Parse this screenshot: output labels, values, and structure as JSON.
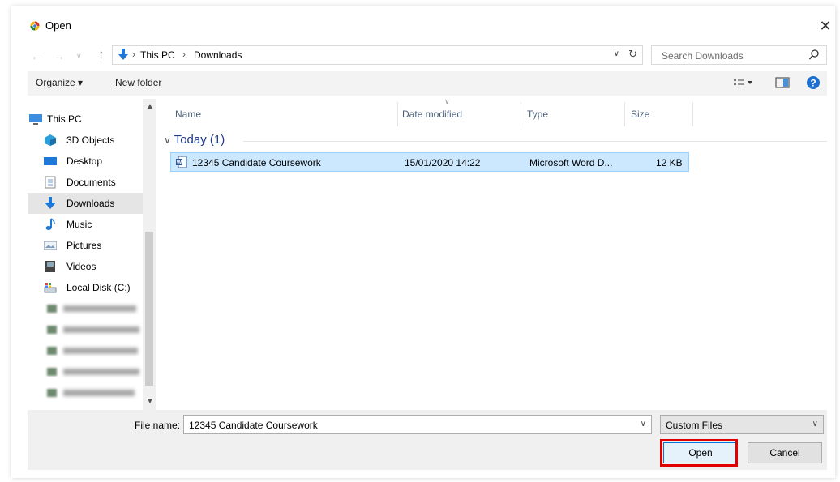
{
  "window": {
    "title": "Open",
    "close_glyph": "✕"
  },
  "address_bar": {
    "crumbs": [
      "This PC",
      "Downloads"
    ],
    "separator": "›",
    "search_placeholder": "Search Downloads"
  },
  "toolbar": {
    "organize_label": "Organize ▾",
    "new_folder_label": "New folder"
  },
  "sidebar": {
    "items": [
      {
        "label": "This PC"
      },
      {
        "label": "3D Objects"
      },
      {
        "label": "Desktop"
      },
      {
        "label": "Documents"
      },
      {
        "label": "Downloads"
      },
      {
        "label": "Music"
      },
      {
        "label": "Pictures"
      },
      {
        "label": "Videos"
      },
      {
        "label": "Local Disk (C:)"
      }
    ],
    "selected_index": 4
  },
  "file_list": {
    "columns": {
      "name": "Name",
      "date": "Date modified",
      "type": "Type",
      "size": "Size"
    },
    "group_header": "Today (1)",
    "rows": [
      {
        "name": "12345 Candidate Coursework",
        "date": "15/01/2020 14:22",
        "type": "Microsoft Word D...",
        "size": "12 KB"
      }
    ]
  },
  "footer": {
    "file_name_label": "File name:",
    "file_name_value": "12345 Candidate Coursework",
    "file_type_filter": "Custom Files",
    "open_label": "Open",
    "cancel_label": "Cancel"
  },
  "colors": {
    "selection": "#cce8ff",
    "highlight_box": "#e00000",
    "folder_blue": "#1e78d7"
  }
}
